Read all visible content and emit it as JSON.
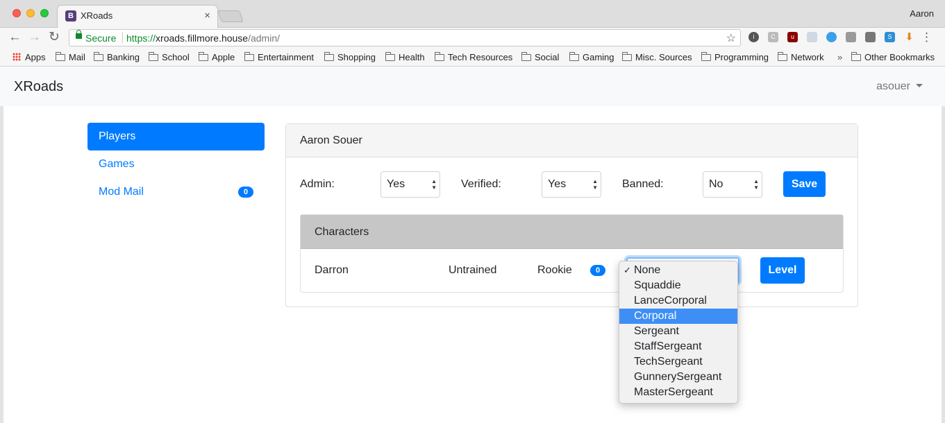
{
  "browser": {
    "tab_title": "XRoads",
    "tab_favicon": "B",
    "profile": "Aaron",
    "secure_label": "Secure",
    "url_scheme": "https://",
    "url_host": "xroads.fillmore.house",
    "url_path": "/admin/",
    "bookmarks": [
      "Apps",
      "Mail",
      "Banking",
      "School",
      "Apple",
      "Entertainment",
      "Shopping",
      "Health",
      "Tech Resources",
      "Social",
      "Gaming",
      "Misc. Sources",
      "Programming",
      "Network"
    ],
    "overflow": "»",
    "other_bookmarks": "Other Bookmarks"
  },
  "app": {
    "brand": "XRoads",
    "user": "asouer"
  },
  "sidebar": {
    "items": [
      {
        "label": "Players"
      },
      {
        "label": "Games"
      },
      {
        "label": "Mod Mail",
        "badge": "0"
      }
    ]
  },
  "player": {
    "name": "Aaron Souer",
    "admin_label": "Admin:",
    "admin_value": "Yes",
    "verified_label": "Verified:",
    "verified_value": "Yes",
    "banned_label": "Banned:",
    "banned_value": "No",
    "save_label": "Save"
  },
  "characters": {
    "title": "Characters",
    "rows": [
      {
        "name": "Darron",
        "training": "Untrained",
        "rank": "Rookie",
        "count": "0",
        "level_label": "Level"
      }
    ]
  },
  "rank_dropdown": {
    "options": [
      "None",
      "Squaddie",
      "LanceCorporal",
      "Corporal",
      "Sergeant",
      "StaffSergeant",
      "TechSergeant",
      "GunnerySergeant",
      "MasterSergeant"
    ],
    "checked": "None",
    "highlighted": "Corporal",
    "check_mark": "✓"
  },
  "colors": {
    "primary": "#007bff",
    "highlight": "#3d8ff5",
    "secure": "#0a8a2a"
  }
}
